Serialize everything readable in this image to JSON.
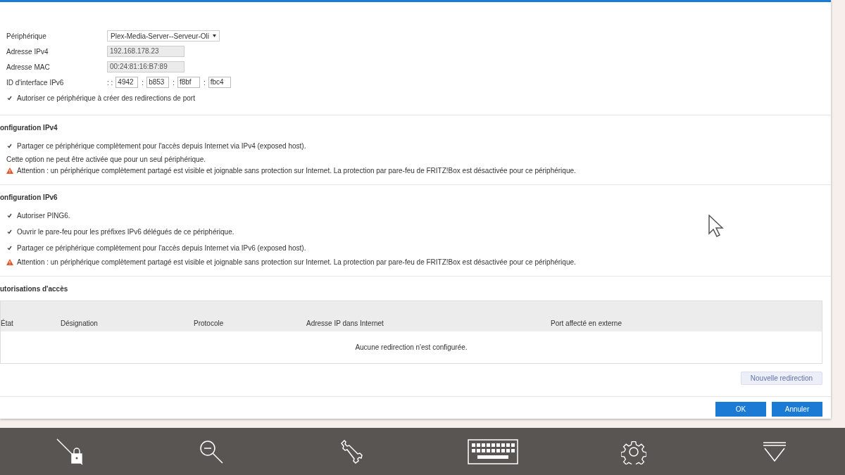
{
  "device": {
    "fields": [
      {
        "kind": "select",
        "label": "Périphérique",
        "value": "Plex-Media-Server--Serveur-Oli"
      },
      {
        "kind": "readonly",
        "label": "Adresse IPv4",
        "value": "192.168.178.23"
      },
      {
        "kind": "readonly",
        "label": "Adresse MAC",
        "value": "00:24:81:16:B7:89"
      },
      {
        "kind": "ipv6",
        "label": "ID d'interface IPv6",
        "segments": [
          {
            "sep": ": :",
            "value": "4942"
          },
          {
            "sep": ":",
            "value": "b853"
          },
          {
            "sep": ":",
            "value": "f8bf"
          },
          {
            "sep": ":",
            "value": "fbc4"
          }
        ]
      }
    ],
    "allow": {
      "label": "Autoriser ce périphérique à créer des redirections de port",
      "checked": true
    }
  },
  "sections": [
    {
      "title": "onfiguration IPv4",
      "items": [
        {
          "kind": "checkbox",
          "label": "Partager ce périphérique complètement pour l'accès depuis Internet via IPv4 (exposed host).",
          "checked": true
        },
        {
          "kind": "note",
          "text": "Cette option ne peut être activée que pour un seul périphérique."
        },
        {
          "kind": "warning",
          "text": "Attention : un périphérique complètement partagé est visible et joignable sans protection sur Internet. La protection par pare-feu de FRITZ!Box est désactivée pour ce périphérique."
        }
      ]
    },
    {
      "title": "onfiguration IPv6",
      "items": [
        {
          "kind": "checkbox",
          "label": "Autoriser PING6.",
          "checked": true
        },
        {
          "kind": "checkbox",
          "label": "Ouvrir le pare-feu pour les préfixes IPv6 délégués de ce périphérique.",
          "checked": true
        },
        {
          "kind": "checkbox",
          "label": "Partager ce périphérique complètement pour l'accès depuis Internet via IPv6 (exposed host).",
          "checked": true
        },
        {
          "kind": "warning",
          "text": "Attention : un périphérique complètement partagé est visible et joignable sans protection sur Internet. La protection par pare-feu de FRITZ!Box est désactivée pour ce périphérique."
        }
      ]
    }
  ],
  "access": {
    "title": "utorisations d'accès",
    "table": {
      "columns": [
        "État",
        "Désignation",
        "Protocole",
        "Adresse IP dans Internet",
        "Port affecté en externe"
      ],
      "empty_message": "Aucune redirection n'est configurée."
    },
    "new_button": "Nouvelle redirection"
  },
  "buttons": [
    {
      "label": "OK",
      "kind": "primary"
    },
    {
      "label": "Annuler",
      "kind": "primary"
    }
  ],
  "toolbar": [
    {
      "kind": "lock-off"
    },
    {
      "kind": "zoom-out"
    },
    {
      "kind": "wrench"
    },
    {
      "kind": "keyboard"
    },
    {
      "kind": "gear"
    },
    {
      "kind": "chevron"
    }
  ]
}
